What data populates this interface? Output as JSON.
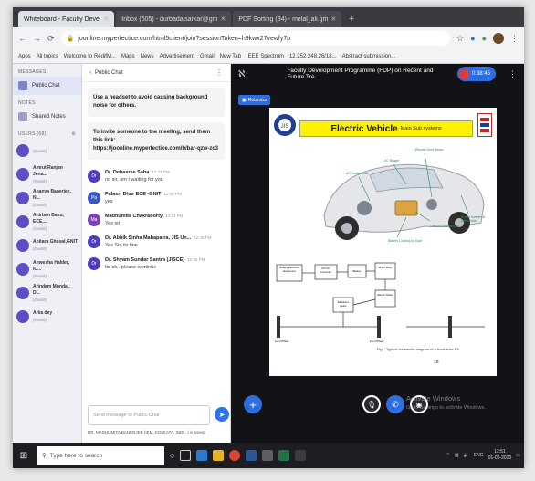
{
  "browser": {
    "tabs": [
      {
        "label": "Whiteboard - Faculty Devel",
        "active": true
      },
      {
        "label": "Inbox (605) - durbadalsarkar@gm",
        "active": false
      },
      {
        "label": "PDF Sorting (84) - melal_ali.gm",
        "active": false
      }
    ],
    "url": "joonline.myperfectice.com/html5client/join?sessionToken=h9kwx27vewfy7p",
    "bookmarks": [
      "Apps",
      "All topics",
      "Welcome to RedifM...",
      "Maps",
      "News",
      "Advertisement",
      "Gmail",
      "New Tab",
      "IEEE Spectrum",
      "12.252.248.26/18...",
      "Abstract submission..."
    ]
  },
  "left_panel": {
    "messages_header": "MESSAGES",
    "public_chat": "Public Chat",
    "notes_header": "NOTES",
    "shared_notes": "Shared Notes",
    "users_header": "USERS (68)",
    "users": [
      {
        "name": "",
        "status": "(Guest)"
      },
      {
        "name": "Amrut Ranjan Jena...",
        "status": "(Guest)"
      },
      {
        "name": "Ananya Banerjee, N...",
        "status": "(Guest)"
      },
      {
        "name": "Anirban Basu, ECE,...",
        "status": "(Guest)"
      },
      {
        "name": "Anitara Ghosal,GNIT",
        "status": "(Guest)"
      },
      {
        "name": "Anwesha Halder, IC...",
        "status": "(Guest)"
      },
      {
        "name": "Arindam Mondal, D...",
        "status": "(Guest)"
      },
      {
        "name": "Arka dey",
        "status": "(Guest)"
      }
    ]
  },
  "chat": {
    "header": "Public Chat",
    "notice1": "Use a headset to avoid causing background noise for others.",
    "notice2": "To invite someone to the meeting, send them this link: https://joonline.myperfectice.com/b/bar-qzw-zc3",
    "messages": [
      {
        "initials": "Dr",
        "name": "Dr. Debasree Saha",
        "time": "12:43 PM",
        "text": "no sir, am I waiting for you"
      },
      {
        "initials": "Pa",
        "name": "Palasri Dhar ECE -GNIT",
        "time": "12:44 PM",
        "text": "yes"
      },
      {
        "initials": "Ma",
        "name": "Madhumita Chakraborty",
        "time": "12:44 PM",
        "text": "Yes sir"
      },
      {
        "initials": "Dr",
        "name": "Dr. Abhik Sinha Mahapatra, JIS Un...",
        "time": "12:45 PM",
        "text": "Yes Sir, its fine"
      },
      {
        "initials": "Dr",
        "name": "Dr. Shyam Sundar Santra (JISCE)",
        "time": "12:46 PM",
        "text": "Its ok.. please continue"
      }
    ],
    "input_placeholder": "Send message to Public Chat",
    "typing": "DR. MADHUMITA BANERJEE (IEM, KOLKATA, INDI...) is typing"
  },
  "stage": {
    "title": "Faculty Development Programme (FDP) on Recent and Future Tre...",
    "people_count": "0:38:45",
    "presenter": "Robindra",
    "slide": {
      "title": "Electric Vehicle",
      "subtitle": "Main Sub systems",
      "labels": [
        "Electric Drive Motor",
        "AC Blower",
        "AC Compressor",
        "Power Inverter & Differential",
        "Lithium Ion Batteries",
        "Battery Cooling Air Duct"
      ],
      "diagram_blocks": [
        "Battery Electrical Equipment",
        "DC-DC Converter",
        "Battery",
        "Motor Drive",
        "Electric Motor",
        "Reduction gears",
        "Front Wheel",
        "Front Wheel"
      ],
      "caption": "Fig. : Typical schematic diagram of a front drive EV",
      "slide_number": "18"
    },
    "watermark_title": "Activate Windows",
    "watermark_sub": "Go to Settings to activate Windows."
  },
  "taskbar": {
    "search_placeholder": "Type here to search",
    "tray_lang": "ENG",
    "time": "12:51",
    "date": "01-06-2020"
  },
  "colors": {
    "accent_blue": "#2d6fe0",
    "avatar_purple": "#4a3fb7",
    "slide_title_yellow": "#fff200"
  }
}
